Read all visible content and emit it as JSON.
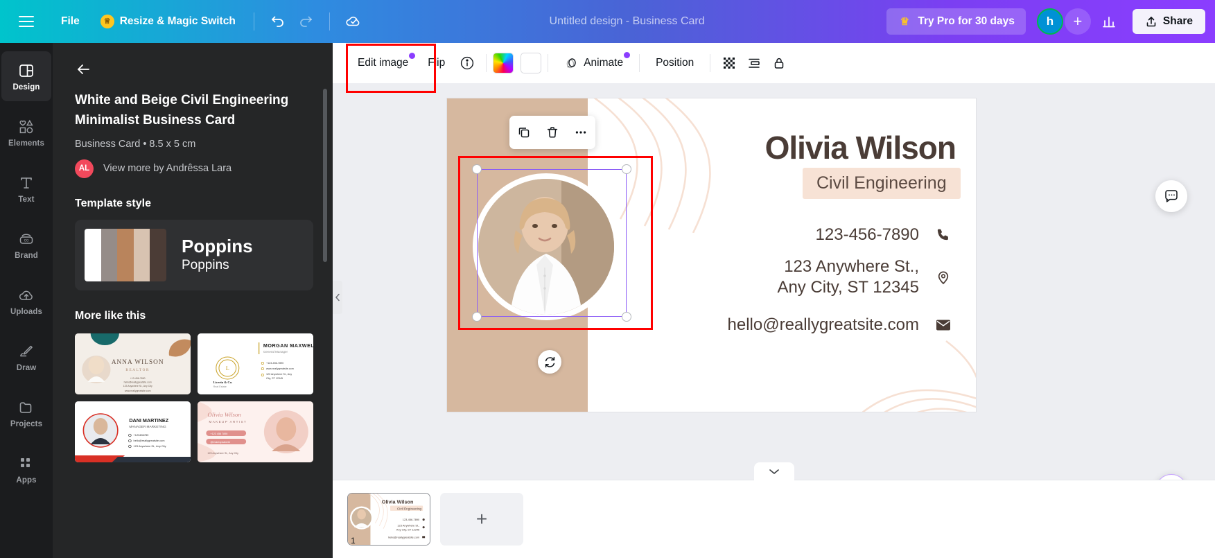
{
  "topbar": {
    "menu_icon": "hamburger-icon",
    "file_label": "File",
    "resize_label": "Resize & Magic Switch",
    "undo_icon": "undo-icon",
    "redo_icon": "redo-icon",
    "cloud_icon": "cloud-saved-icon",
    "doc_title": "Untitled design - Business Card",
    "try_pro_label": "Try Pro for 30 days",
    "avatar_initial": "h",
    "add_icon": "plus-icon",
    "insights_icon": "bar-chart-icon",
    "share_label": "Share",
    "share_icon": "share-upload-icon"
  },
  "rail": {
    "items": [
      {
        "label": "Design",
        "icon": "design-icon",
        "active": true
      },
      {
        "label": "Elements",
        "icon": "elements-icon",
        "active": false
      },
      {
        "label": "Text",
        "icon": "text-icon",
        "active": false
      },
      {
        "label": "Brand",
        "icon": "brand-icon",
        "active": false
      },
      {
        "label": "Uploads",
        "icon": "uploads-icon",
        "active": false
      },
      {
        "label": "Draw",
        "icon": "draw-icon",
        "active": false
      },
      {
        "label": "Projects",
        "icon": "projects-icon",
        "active": false
      },
      {
        "label": "Apps",
        "icon": "apps-icon",
        "active": false
      }
    ]
  },
  "panel": {
    "back_icon": "arrow-left-icon",
    "template_title": "White and Beige Civil Engineering Minimalist Business Card",
    "template_meta": "Business Card • 8.5 x 5 cm",
    "author_initials": "AL",
    "author_link": "View more by Andrêssa Lara",
    "style_section_label": "Template style",
    "style_primary": "Poppins",
    "style_secondary": "Poppins",
    "swatches": [
      "#ffffff",
      "#958c88",
      "#b9845c",
      "#d8c3b1",
      "#4b3c36"
    ],
    "more_section_label": "More like this",
    "thumbs": [
      {
        "name": "ANNA WILSON",
        "role": "REALTOR"
      },
      {
        "name": "MORGAN MAXWELL",
        "role": "General Manager"
      },
      {
        "name": "DANI MARTINEZ",
        "role": "MANAGER MARKETING"
      },
      {
        "name": "Olivia Wilson",
        "role": "MAKEUP ARTIST"
      }
    ]
  },
  "toolbar": {
    "edit_image_label": "Edit image",
    "flip_label": "Flip",
    "info_icon": "info-icon",
    "color_icon": "rainbow-color-icon",
    "border_color_icon": "white-color-icon",
    "animate_label": "Animate",
    "animate_icon": "animate-icon",
    "position_label": "Position",
    "transparency_icon": "transparency-icon",
    "layers_icon": "layers-icon",
    "lock_icon": "lock-icon"
  },
  "float_tools": {
    "duplicate_icon": "duplicate-icon",
    "delete_icon": "trash-icon",
    "more_icon": "more-horizontal-icon",
    "rotate_icon": "rotate-icon"
  },
  "card": {
    "name": "Olivia Wilson",
    "role": "Civil Engineering",
    "phone": "123-456-7890",
    "address_line1": "123 Anywhere St.,",
    "address_line2": "Any City, ST 12345",
    "email": "hello@reallygreatsite.com",
    "phone_icon": "phone-icon",
    "location_icon": "location-pin-icon",
    "email_icon": "envelope-icon",
    "bg_left_color": "#d6b89f",
    "accent_color": "#f7e2d5",
    "text_color": "#4a3c36"
  },
  "fabs": {
    "comment_icon": "comment-icon",
    "magic_icon": "magic-sparkle-icon"
  },
  "bottom": {
    "collapse_icon": "chevron-down-icon",
    "page_number": "1",
    "add_page_icon": "plus-icon",
    "thumb_name": "Olivia Wilson",
    "thumb_role": "Civil Engineering",
    "thumb_phone": "123-456-7890",
    "thumb_addr1": "123 Anywhere St.,",
    "thumb_addr2": "Any City, ST 12345",
    "thumb_email": "hello@reallygreatsite.com"
  }
}
